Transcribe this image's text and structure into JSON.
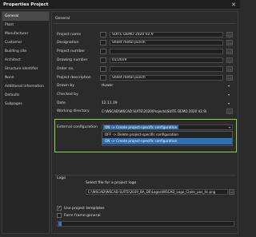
{
  "window": {
    "title": "Properties Project",
    "close_glyph": "✕"
  },
  "sidebar": {
    "items": [
      {
        "label": "General",
        "active": true
      },
      {
        "label": "Plant"
      },
      {
        "label": "Manufacturer"
      },
      {
        "label": "Customer"
      },
      {
        "label": "Building site"
      },
      {
        "label": "Architect"
      },
      {
        "label": "Structure identifier"
      },
      {
        "label": "None"
      },
      {
        "label": "Additional information"
      },
      {
        "label": "Defaults"
      },
      {
        "label": "Subpages"
      }
    ]
  },
  "general": {
    "title": "General",
    "fields": [
      {
        "label": "Project name",
        "value": "SUITE DEMO 2020 V2.9",
        "type": "text"
      },
      {
        "label": "Designation",
        "value": "Sheet metal punch",
        "type": "text"
      },
      {
        "label": "Project number",
        "value": "",
        "type": "text"
      },
      {
        "label": "Drawing number",
        "value": "01/2019",
        "type": "text"
      },
      {
        "label": "Order no.",
        "value": "",
        "type": "text"
      },
      {
        "label": "Project description",
        "value": "Sheet metal punch",
        "type": "text"
      },
      {
        "label": "Drawn by",
        "value": "Huwer",
        "type": "select"
      },
      {
        "label": "Checked by",
        "value": "",
        "type": "select"
      },
      {
        "label": "Date",
        "value": "12.11.19",
        "type": "date"
      },
      {
        "label": "Working directory",
        "value": "C:\\WSCAD\\WSCAD SUITE\\2020\\Projects\\SUITE DEMO 2020 V2.9\\",
        "type": "path"
      }
    ],
    "side_button_glyph": "…"
  },
  "external_configuration": {
    "label": "External configuration",
    "selected": "ON -> Create project-specific configuration",
    "options": [
      {
        "label": "OFF -> Delete project-specific configuration",
        "highlighted": false
      },
      {
        "label": "ON -> Create project-specific configuration",
        "highlighted": true
      }
    ]
  },
  "logo": {
    "section_label": "Logo",
    "hint": "Select file for a project logo",
    "path": "C:\\WSCAD\\WSCAD SUITE\\2019_BA_DE\\Logos\\WSCAD_Logo_Claim_pos_4c.png"
  },
  "options": {
    "use_project_templates": {
      "label": "Use project templates",
      "checked": true
    },
    "form_frame_general": {
      "label": "Form frame general",
      "checked": false
    }
  },
  "colors": {
    "accent": "#8fd14f",
    "selection": "#2f6fb5",
    "background": "#2b2b2b"
  }
}
